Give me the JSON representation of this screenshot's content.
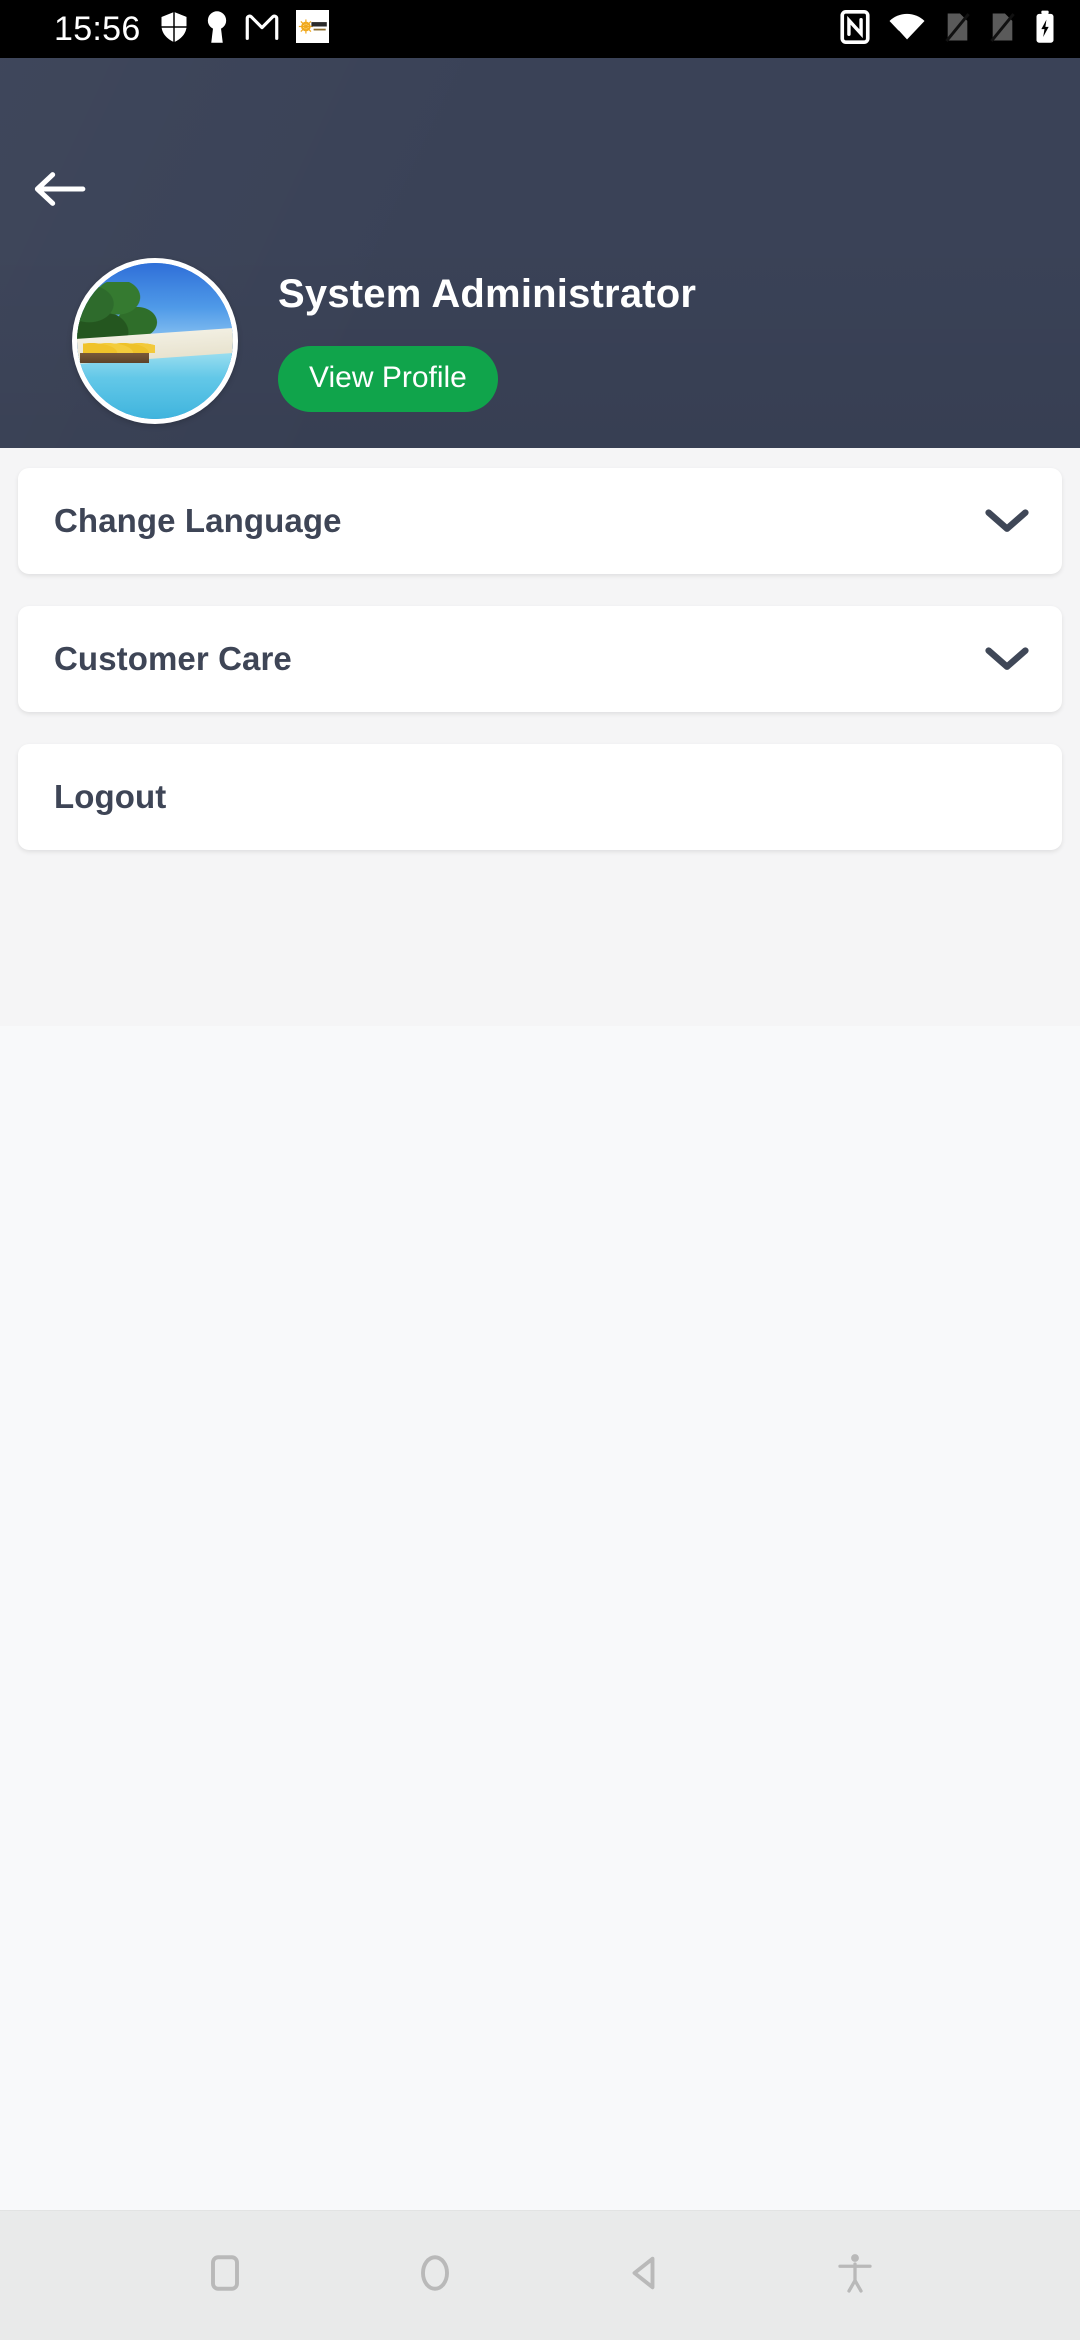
{
  "status_bar": {
    "clock": "15:56",
    "left_icons": [
      "shield-icon",
      "vpn-key-icon",
      "gmail-icon",
      "app-notification-icon"
    ],
    "right_icons": [
      "nfc-icon",
      "wifi-icon",
      "sim1-no-signal-icon",
      "sim2-no-signal-icon",
      "battery-charging-icon"
    ],
    "background_color": "#000000",
    "foreground_color": "#ffffff"
  },
  "header": {
    "background_color": "#3a4257",
    "back_button": "back-arrow-icon",
    "avatar_alt": "tropical-beach-profile-photo",
    "user_name": "System Administrator",
    "view_profile_label": "View Profile",
    "view_profile_color": "#10a44b"
  },
  "menu": {
    "background_color": "#f5f5f6",
    "items": [
      {
        "label": "Change Language",
        "expandable": true,
        "icon": "chevron-down-icon"
      },
      {
        "label": "Customer Care",
        "expandable": true,
        "icon": "chevron-down-icon"
      },
      {
        "label": "Logout",
        "expandable": false,
        "icon": ""
      }
    ],
    "text_color": "#3e4556"
  },
  "nav_bar": {
    "background_color": "#e9eaea",
    "buttons": [
      {
        "name": "recents-button",
        "icon": "square-icon"
      },
      {
        "name": "home-button",
        "icon": "circle-icon"
      },
      {
        "name": "back-button",
        "icon": "triangle-left-icon"
      },
      {
        "name": "accessibility-button",
        "icon": "accessibility-icon"
      }
    ]
  }
}
